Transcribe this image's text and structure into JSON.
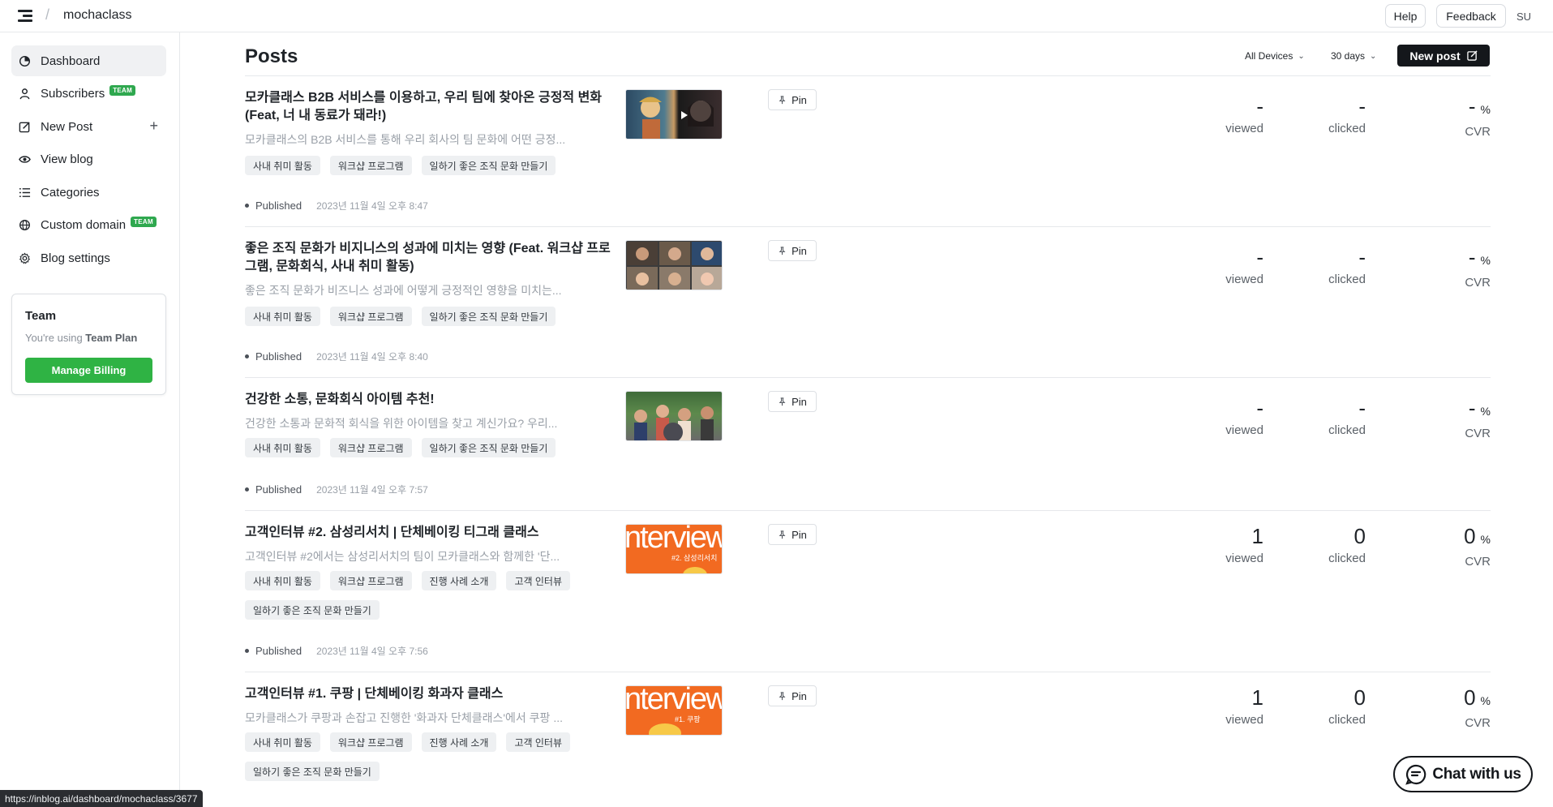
{
  "topbar": {
    "workspace": "mochaclass",
    "help": "Help",
    "feedback": "Feedback",
    "avatar": "SU"
  },
  "sidebar": {
    "items": [
      {
        "label": "Dashboard",
        "icon": "dashboard-icon",
        "active": true
      },
      {
        "label": "Subscribers",
        "icon": "user-icon",
        "badge": "TEAM"
      },
      {
        "label": "New Post",
        "icon": "edit-icon",
        "action": "+"
      },
      {
        "label": "View blog",
        "icon": "eye-icon"
      },
      {
        "label": "Categories",
        "icon": "list-icon"
      },
      {
        "label": "Custom domain",
        "icon": "globe-icon",
        "badge": "TEAM"
      },
      {
        "label": "Blog settings",
        "icon": "gear-icon"
      }
    ],
    "team": {
      "title": "Team",
      "sub_prefix": "You're using ",
      "sub_plan": "Team Plan",
      "button": "Manage Billing"
    }
  },
  "main": {
    "title": "Posts",
    "device_filter": "All Devices",
    "period_filter": "30 days",
    "new_post": "New post",
    "pin_label": "Pin",
    "viewed_label": "viewed",
    "clicked_label": "clicked",
    "cvr_label": "CVR",
    "percent": "%"
  },
  "posts": [
    {
      "title": "모카클래스 B2B 서비스를 이용하고, 우리 팀에 찾아온 긍정적 변화 (Feat, 너 내 동료가 돼라!)",
      "excerpt": "모카클래스의 B2B 서비스를 통해 우리 회사의 팀 문화에 어떤 긍정...",
      "tags": [
        "사내 취미 활동",
        "워크샵 프로그램",
        "일하기 좋은 조직 문화 만들기"
      ],
      "status": "Published",
      "time": "2023년 11월 4일 오후 8:47",
      "viewed": "-",
      "clicked": "-",
      "cvr": "-",
      "thumb": "anime-video-thumbnail"
    },
    {
      "title": "좋은 조직 문화가 비지니스의 성과에 미치는 영향 (Feat. 워크샵 프로그램, 문화회식, 사내 취미 활동)",
      "excerpt": "좋은 조직 문화가 비즈니스 성과에 어떻게 긍정적인 영향을 미치는...",
      "tags": [
        "사내 취미 활동",
        "워크샵 프로그램",
        "일하기 좋은 조직 문화 만들기"
      ],
      "status": "Published",
      "time": "2023년 11월 4일 오후 8:40",
      "viewed": "-",
      "clicked": "-",
      "cvr": "-",
      "thumb": "faces-grid-thumbnail"
    },
    {
      "title": "건강한 소통, 문화회식 아이템 추천!",
      "excerpt": "건강한 소통과 문화적 회식을 위한 아이템을 찾고 계신가요? 우리...",
      "tags": [
        "사내 취미 활동",
        "워크샵 프로그램",
        "일하기 좋은 조직 문화 만들기"
      ],
      "status": "Published",
      "time": "2023년 11월 4일 오후 7:57",
      "viewed": "-",
      "clicked": "-",
      "cvr": "-",
      "thumb": "group-photo-thumbnail"
    },
    {
      "title": "고객인터뷰 #2. 삼성리서치 | 단체베이킹 티그래 클래스",
      "excerpt": "고객인터뷰 #2에서는 삼성리서치의 팀이 모카클래스와 함께한 '단...",
      "tags": [
        "사내 취미 활동",
        "워크샵 프로그램",
        "진행 사례 소개",
        "고객 인터뷰",
        "일하기 좋은 조직 문화 만들기"
      ],
      "status": "Published",
      "time": "2023년 11월 4일 오후 7:56",
      "viewed": "1",
      "clicked": "0",
      "cvr": "0",
      "thumb": "interview-thumbnail",
      "thumb_text": "nterview",
      "thumb_sub": "#2. 삼성리서치"
    },
    {
      "title": "고객인터뷰 #1. 쿠팡 | 단체베이킹 화과자 클래스",
      "excerpt": "모카클래스가 쿠팡과 손잡고 진행한 '화과자 단체클래스'에서 쿠팡 ...",
      "tags": [
        "사내 취미 활동",
        "워크샵 프로그램",
        "진행 사례 소개",
        "고객 인터뷰",
        "일하기 좋은 조직 문화 만들기"
      ],
      "status": "",
      "time": "",
      "viewed": "1",
      "clicked": "0",
      "cvr": "0",
      "thumb": "interview-thumbnail",
      "thumb_text": "nterview",
      "thumb_sub": "#1. 쿠팡"
    }
  ],
  "status_url": "https://inblog.ai/dashboard/mochaclass/3677",
  "chat_button": "Chat with us",
  "colors": {
    "accent_green": "#2fb344",
    "badge_green": "#2fa84f",
    "primary_dark": "#14171b",
    "thumb_orange": "#f26a21"
  }
}
